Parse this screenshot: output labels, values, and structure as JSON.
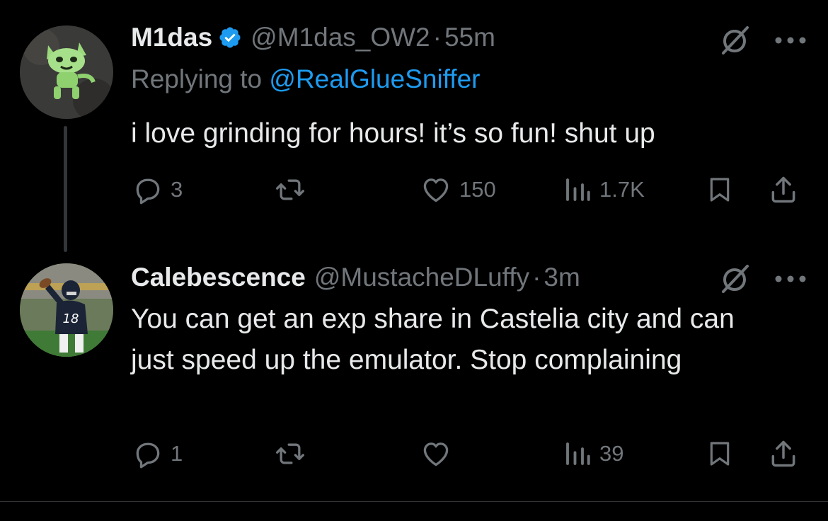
{
  "colors": {
    "background": "#000000",
    "text_primary": "#e7e9ea",
    "text_secondary": "#71767b",
    "accent": "#1d9bf0",
    "verified": "#1d9bf0"
  },
  "tweets": [
    {
      "display_name": "M1das",
      "verified": true,
      "handle": "@M1das_OW2",
      "separator": "·",
      "time": "55m",
      "reply_label": "Replying to ",
      "reply_mention": "@RealGlueSniffer",
      "text": "i love grinding for hours! it’s so fun! shut up",
      "avatar_icon": "green-cat-creature-avatar",
      "actions": {
        "replies": "3",
        "retweets": "",
        "likes": "150",
        "views": "1.7K"
      }
    },
    {
      "display_name": "Calebescence",
      "verified": false,
      "handle": "@MustacheDLuffy",
      "separator": "·",
      "time": "3m",
      "text": "You can get an exp share in Castelia city and can just speed up the emulator. Stop complaining",
      "avatar_icon": "football-player-avatar",
      "actions": {
        "replies": "1",
        "retweets": "",
        "likes": "",
        "views": "39"
      }
    }
  ]
}
